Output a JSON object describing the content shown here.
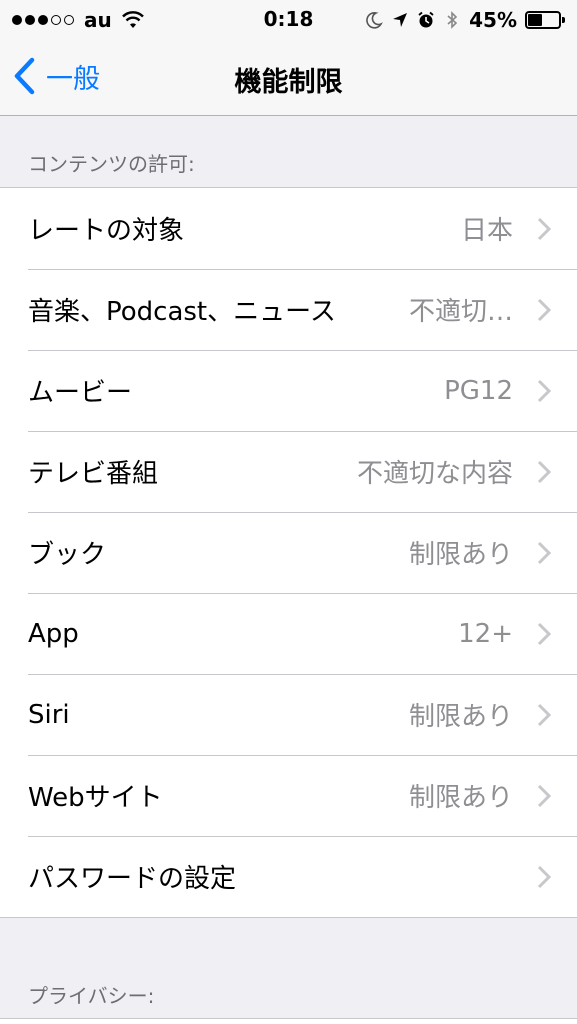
{
  "status_bar": {
    "carrier": "au",
    "time": "0:18",
    "battery_percent": "45%",
    "battery_level": 0.45,
    "signal_bars_filled": 3,
    "signal_bars_total": 5,
    "icons": [
      "wifi-icon",
      "moon-icon",
      "location-arrow-icon",
      "alarm-icon",
      "bluetooth-icon",
      "battery-icon"
    ]
  },
  "nav": {
    "back_label": "一般",
    "title": "機能制限",
    "accent_color": "#0a7aff"
  },
  "sections": [
    {
      "header": "コンテンツの許可:",
      "rows": [
        {
          "label": "レートの対象",
          "value": "日本"
        },
        {
          "label": "音楽、Podcast、ニュース",
          "value": "不適切…"
        },
        {
          "label": "ムービー",
          "value": "PG12"
        },
        {
          "label": "テレビ番組",
          "value": "不適切な内容"
        },
        {
          "label": "ブック",
          "value": "制限あり"
        },
        {
          "label": "App",
          "value": "12+"
        },
        {
          "label": "Siri",
          "value": "制限あり"
        },
        {
          "label": "Webサイト",
          "value": "制限あり"
        },
        {
          "label": "パスワードの設定",
          "value": ""
        }
      ]
    },
    {
      "header": "プライバシー:"
    }
  ]
}
